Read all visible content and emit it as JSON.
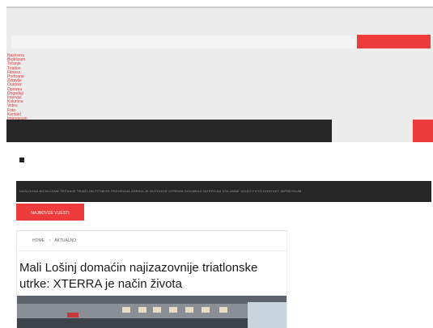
{
  "nav": {
    "items": [
      "Naslovna",
      "Biciklizam",
      "Trčanje",
      "Triatlon",
      "Fitness",
      "Prehrana",
      "Zdravlje",
      "Outdoor",
      "Oprema",
      "Događaji",
      "Intervjui",
      "Kolumne",
      "Video",
      "Foto",
      "Kontakt",
      "Impressum"
    ]
  },
  "ticker": {
    "text": "NASLOVNA BICIKLIZAM TRČANJE TRIATLON FITNESS PREHRANA ZDRAVLJE OUTDOOR OPREMA DOGAĐAJI INTERVJUI KOLUMNE VIDEO FOTO KONTAKT IMPRESSUM"
  },
  "section_label": "Najnovije vijesti",
  "breadcrumb": {
    "home": "HOME",
    "separator": "›",
    "current": "AKTUALNO"
  },
  "article": {
    "title": "Mali Lošinj domaćin najizazovnije triatlonske utrke: XTERRA je način života"
  },
  "colors": {
    "accent": "#ee3c3c",
    "dark": "#262626",
    "band": "#ececec"
  }
}
